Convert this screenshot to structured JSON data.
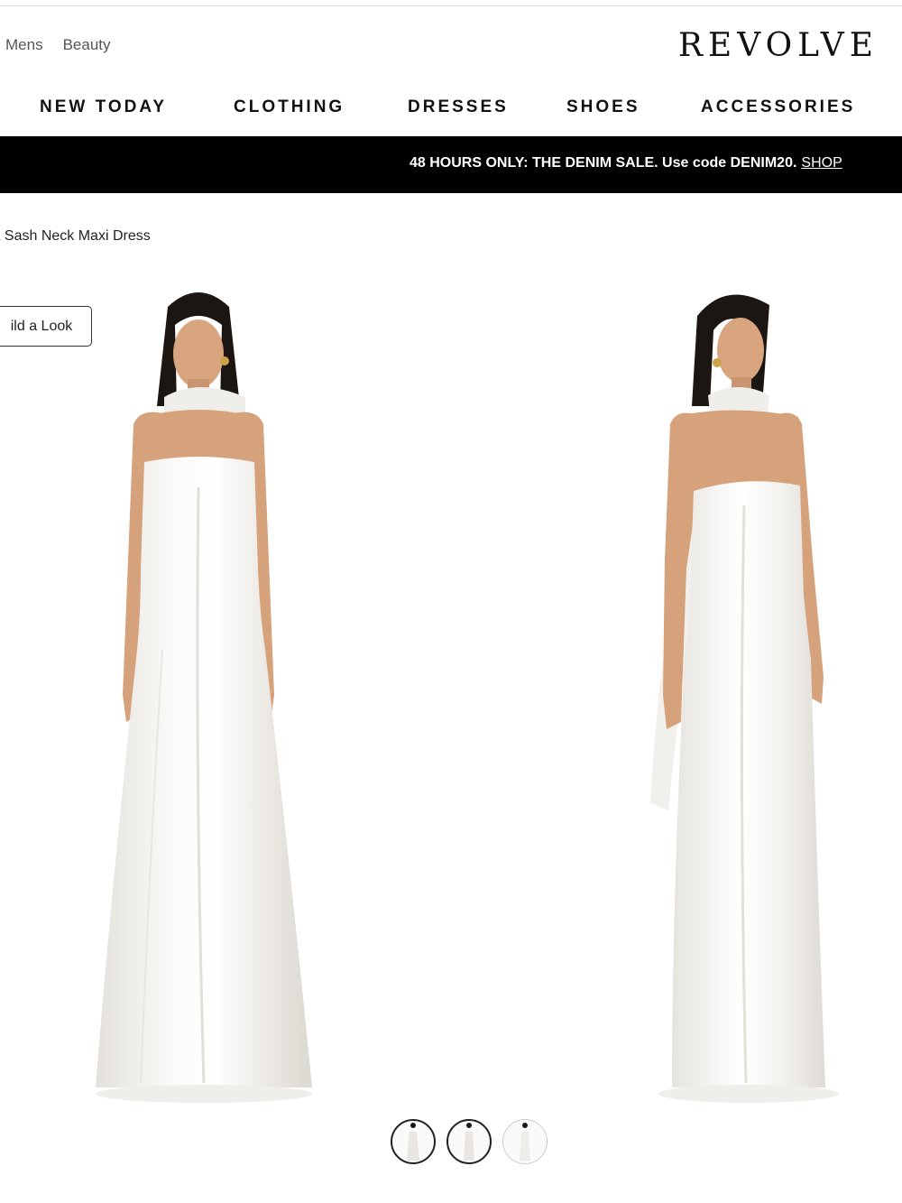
{
  "header": {
    "util_links": [
      "Mens",
      "Beauty"
    ],
    "logo": "REVOLVE"
  },
  "nav": {
    "items": [
      "NEW TODAY",
      "CLOTHING",
      "DRESSES",
      "SHOES",
      "ACCESSORIES"
    ]
  },
  "promo": {
    "text": "48 HOURS ONLY: THE DENIM SALE. Use code DENIM20.",
    "cta": "SHOP"
  },
  "breadcrumb": {
    "product_name": "ia Sash Neck Maxi Dress"
  },
  "build_look": {
    "label": "ild a Look"
  },
  "gallery": {
    "main_images": [
      "dress-front-view",
      "dress-side-view"
    ],
    "thumbnails": [
      {
        "state": "selected"
      },
      {
        "state": "selected"
      },
      {
        "state": "unselected"
      }
    ]
  },
  "colors": {
    "promo_bg": "#000000",
    "promo_text": "#ffffff",
    "dress": "#f3f1ee",
    "skin": "#d9a57f",
    "hair": "#1c1612"
  }
}
